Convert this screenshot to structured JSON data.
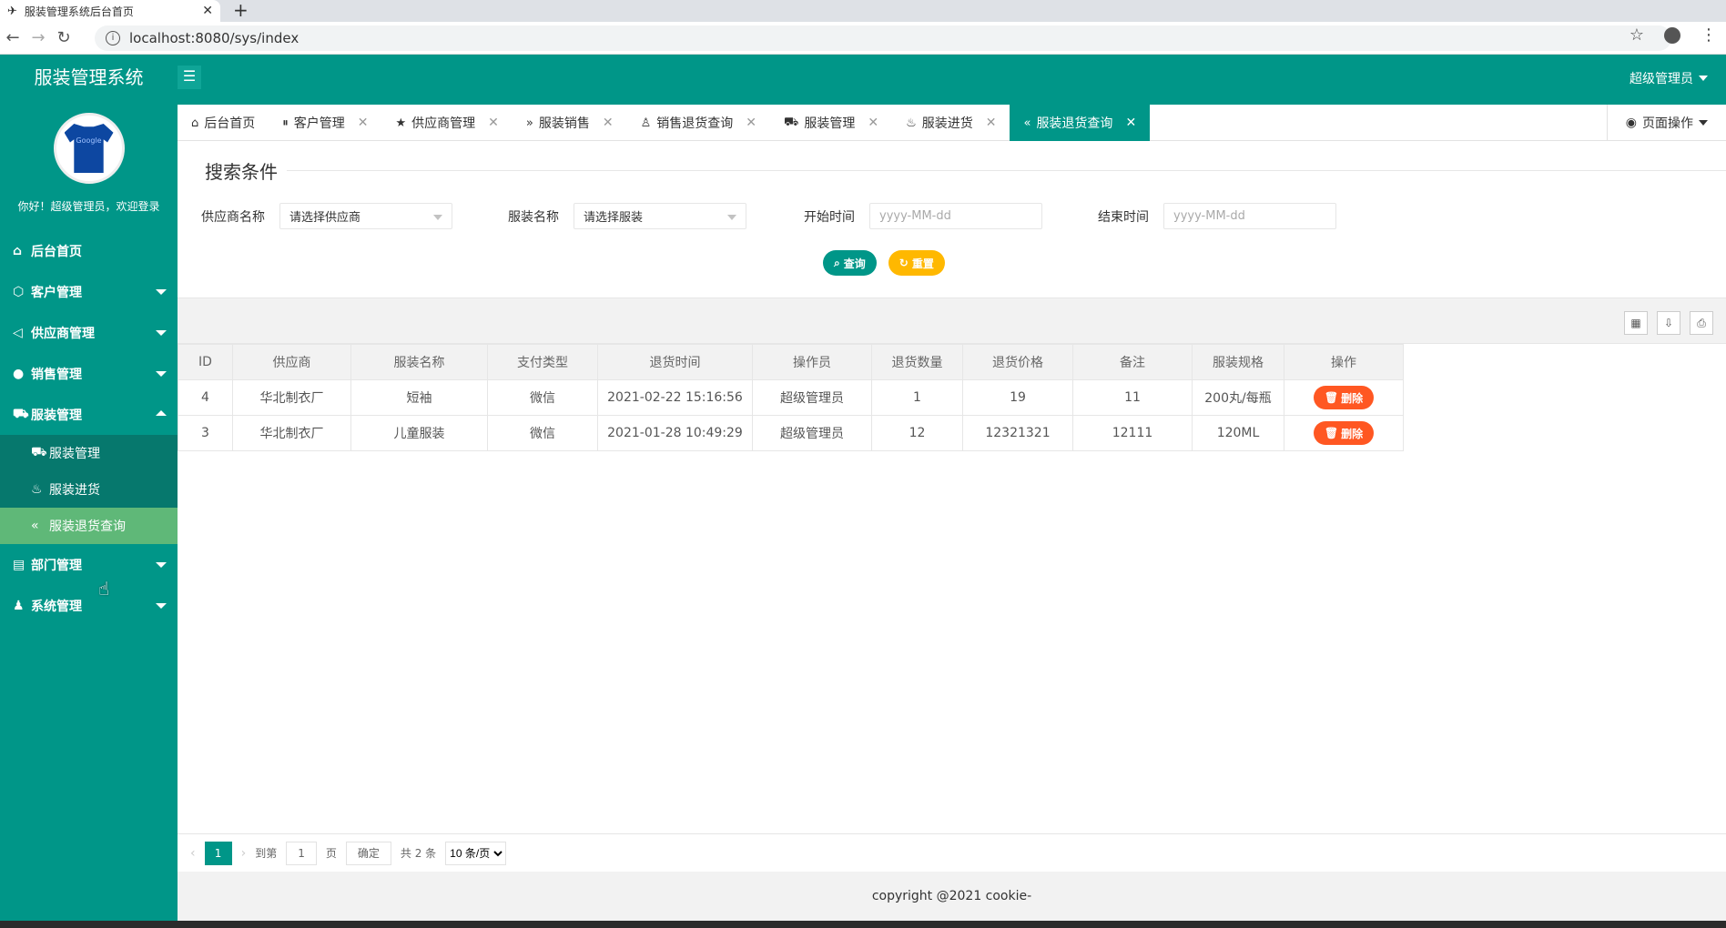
{
  "browser": {
    "tab_title": "服装管理系统后台首页",
    "url": "localhost:8080/sys/index"
  },
  "app": {
    "brand": "服装管理系统",
    "welcome": "你好！超级管理员，欢迎登录",
    "admin_name": "超级管理员",
    "avatar_text": "Google",
    "accent_color": "#009688"
  },
  "sidebar": {
    "items": [
      {
        "label": "后台首页",
        "icon": "home-icon"
      },
      {
        "label": "客户管理",
        "icon": "cube-icon"
      },
      {
        "label": "供应商管理",
        "icon": "speaker-icon"
      },
      {
        "label": "销售管理",
        "icon": "chat-icon"
      },
      {
        "label": "服装管理",
        "icon": "cart-icon"
      },
      {
        "label": "部门管理",
        "icon": "building-icon"
      },
      {
        "label": "系统管理",
        "icon": "user-icon"
      }
    ],
    "sub_items": [
      {
        "label": "服装管理",
        "icon": "cart-icon"
      },
      {
        "label": "服装进货",
        "icon": "fire-icon"
      },
      {
        "label": "服装退货查询",
        "icon": "double-left-icon"
      }
    ]
  },
  "tabs": [
    {
      "label": "后台首页"
    },
    {
      "label": "客户管理"
    },
    {
      "label": "供应商管理"
    },
    {
      "label": "服装销售"
    },
    {
      "label": "销售退货查询"
    },
    {
      "label": "服装管理"
    },
    {
      "label": "服装进货"
    },
    {
      "label": "服装退货查询"
    }
  ],
  "page_ops": "页面操作",
  "search": {
    "title": "搜索条件",
    "supplier_label": "供应商名称",
    "supplier_value": "请选择供应商",
    "clothing_label": "服装名称",
    "clothing_value": "请选择服装",
    "start_label": "开始时间",
    "start_placeholder": "yyyy-MM-dd",
    "end_label": "结束时间",
    "end_placeholder": "yyyy-MM-dd",
    "query_btn": "查询",
    "reset_btn": "重置"
  },
  "table": {
    "headers": [
      "ID",
      "供应商",
      "服装名称",
      "支付类型",
      "退货时间",
      "操作员",
      "退货数量",
      "退货价格",
      "备注",
      "服装规格",
      "操作"
    ],
    "rows": [
      [
        "4",
        "华北制衣厂",
        "短袖",
        "微信",
        "2021-02-22 15:16:56",
        "超级管理员",
        "1",
        "19",
        "11",
        "200丸/每瓶",
        "删除"
      ],
      [
        "3",
        "华北制衣厂",
        "儿童服装",
        "微信",
        "2021-01-28 10:49:29",
        "超级管理员",
        "12",
        "12321321",
        "12111",
        "120ML",
        "删除"
      ]
    ]
  },
  "pager": {
    "current": "1",
    "goto_label": "到第",
    "goto_value": "1",
    "page_unit": "页",
    "confirm": "确定",
    "total": "共 2 条",
    "per_page": "10 条/页"
  },
  "footer": "copyright @2021 cookie-"
}
